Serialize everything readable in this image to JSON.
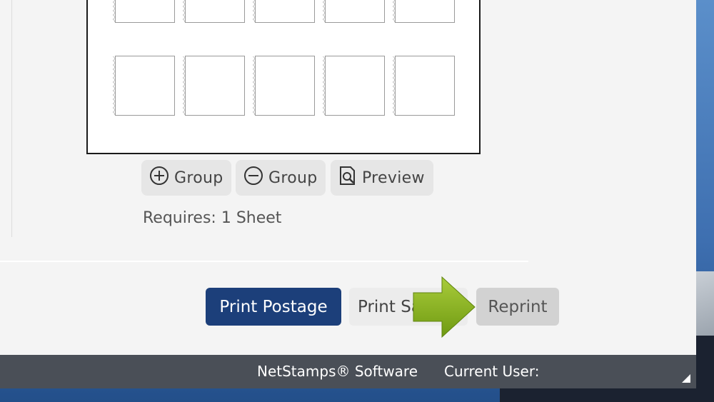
{
  "toolbar": {
    "add_group": "Group",
    "remove_group": "Group",
    "preview": "Preview"
  },
  "sheet_info": {
    "requires_label": "Requires:",
    "requires_value": "1 Sheet"
  },
  "actions": {
    "print_postage": "Print Postage",
    "print_sample": "Print Sa",
    "reprint": "Reprint"
  },
  "statusbar": {
    "product": "NetStamps® Software",
    "current_user_label": "Current User:"
  },
  "colors": {
    "primary_button": "#1c3f7a",
    "arrow": "#8cb31f",
    "statusbar": "#4a4f57"
  },
  "icons": [
    "plus-circle-icon",
    "minus-circle-icon",
    "preview-icon",
    "arrow-right-icon",
    "resize-grip-icon"
  ]
}
